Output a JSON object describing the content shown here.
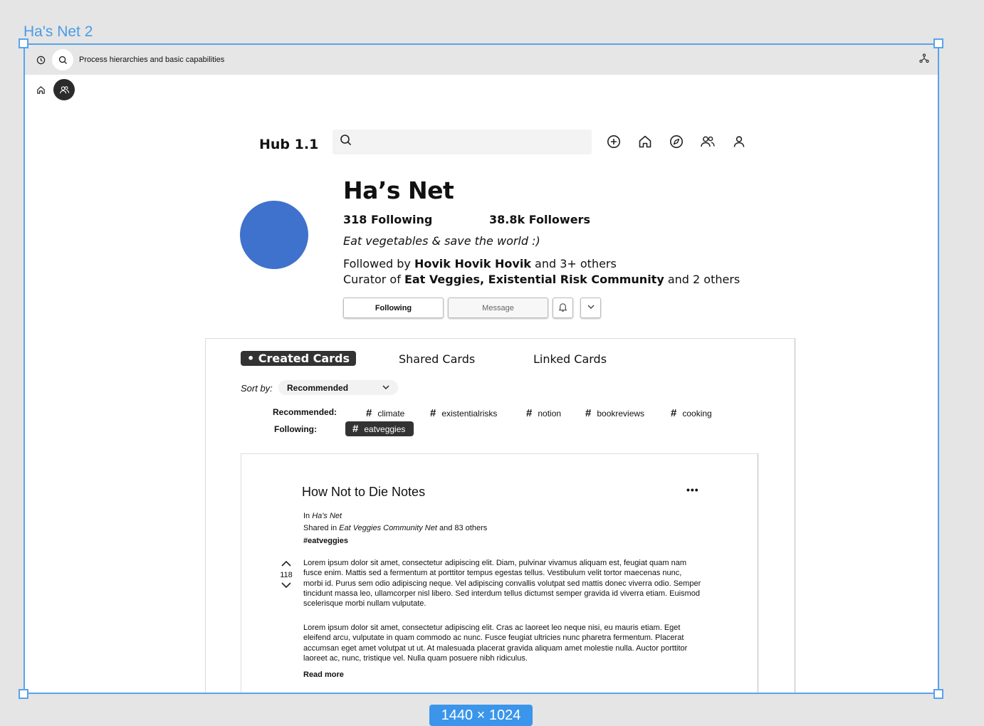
{
  "frame": {
    "label": "Ha's Net 2",
    "size_badge": "1440 × 1024"
  },
  "topbar": {
    "title": "Process hierarchies and basic capabilities"
  },
  "header": {
    "hub_title": "Hub 1.1",
    "search_placeholder": ""
  },
  "profile": {
    "name": "Ha’s Net",
    "following": "318 Following",
    "followers": "38.8k Followers",
    "bio": "Eat vegetables & save the world :)",
    "followed_by_prefix": "Followed by ",
    "followed_by_names": "Hovik Hovik Hovik",
    "followed_by_suffix": " and 3+ others",
    "curator_prefix": "Curator of ",
    "curator_names": "Eat Veggies, Existential Risk Community",
    "curator_suffix": " and 2 others",
    "btn_following": "Following",
    "btn_message": "Message"
  },
  "tabs": {
    "created": "• Created Cards",
    "shared": "Shared Cards",
    "linked": "Linked Cards"
  },
  "sort": {
    "label": "Sort by:",
    "value": "Recommended"
  },
  "tags": {
    "recommended_label": "Recommended:",
    "following_label": "Following:",
    "recommended": [
      "climate",
      "existentialrisks",
      "notion",
      "bookreviews",
      "cooking"
    ],
    "following": [
      "eatveggies"
    ]
  },
  "card": {
    "title": "How Not to Die Notes",
    "more": "•••",
    "in_prefix": "In ",
    "in_net": "Ha's Net",
    "shared_prefix": "Shared in ",
    "shared_net": "Eat Veggies Community Net",
    "shared_suffix": " and 83 others",
    "hashtag": "#eatveggies",
    "votes": "118",
    "para1": "Lorem ipsum dolor sit amet, consectetur adipiscing elit. Diam, pulvinar vivamus aliquam est, feugiat quam nam fusce enim. Mattis sed a fermentum at porttitor tempus egestas tellus. Vestibulum velit tortor maecenas nunc, morbi id. Purus sem odio adipiscing neque. Vel adipiscing convallis volutpat sed mattis donec viverra odio. Semper tincidunt massa leo, ullamcorper nisl libero. Sed interdum tellus dictumst semper gravida id viverra etiam. Euismod scelerisque morbi nullam vulputate.",
    "para2": "Lorem ipsum dolor sit amet, consectetur adipiscing elit. Cras ac laoreet leo neque nisi, eu mauris etiam. Eget eleifend arcu, vulputate in quam commodo ac nunc. Fusce feugiat ultricies nunc pharetra fermentum. Placerat accumsan eget amet volutpat ut ut. At malesuada placerat gravida aliquam amet molestie nulla. Auctor porttitor laoreet ac, nunc, tristique vel. Nulla quam posuere nibh ridiculus.",
    "read_more": "Read more"
  },
  "colors": {
    "accent": "#5aa3ea",
    "avatar": "#3f72cc",
    "dark": "#333333"
  }
}
